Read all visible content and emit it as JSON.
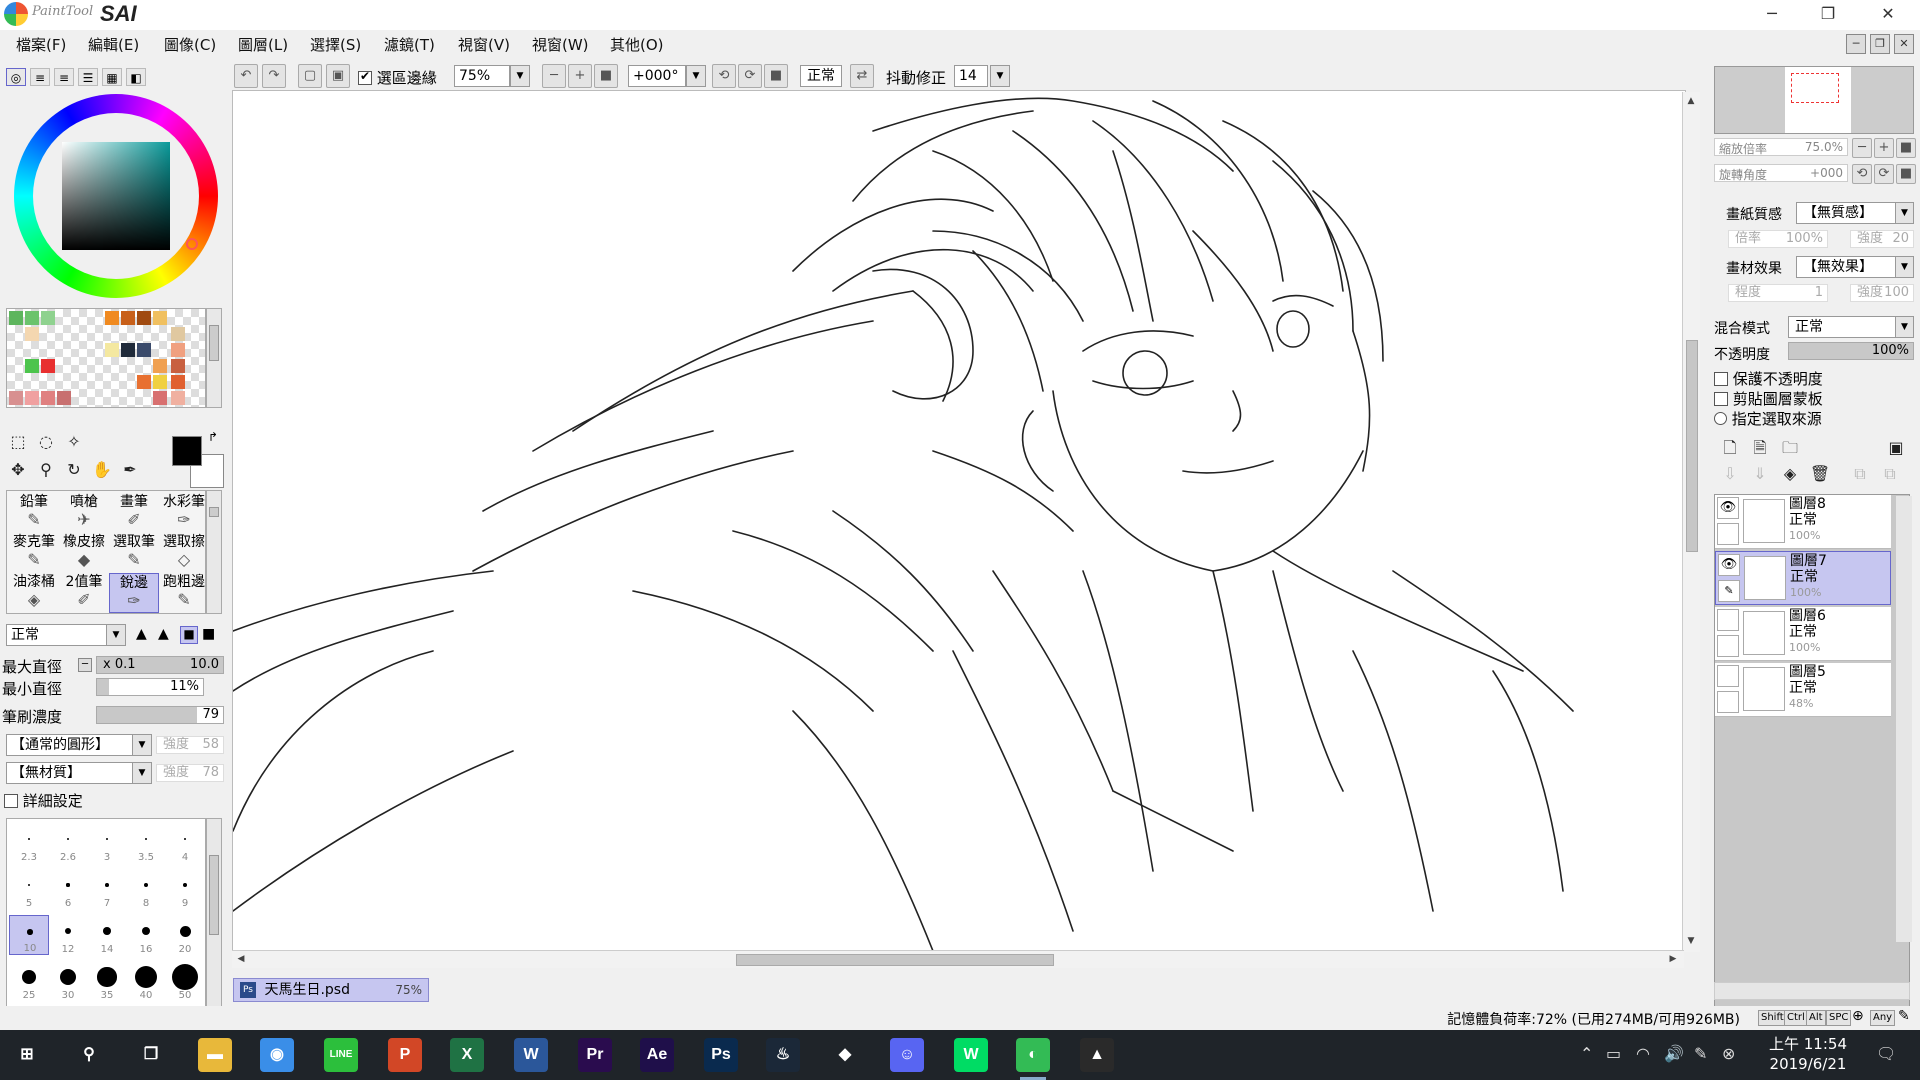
{
  "app": {
    "name_script": "PaintTool",
    "name_bold": "SAI",
    "window_controls": {
      "minimize": "─",
      "maximize": "❐",
      "close": "✕"
    }
  },
  "menu": [
    "檔案(F)",
    "編輯(E)",
    "圖像(C)",
    "圖層(L)",
    "選擇(S)",
    "濾鏡(T)",
    "視窗(V)",
    "視窗(W)",
    "其他(O)"
  ],
  "toolbar": {
    "selection_edge_label": "選區邊緣",
    "selection_edge_checked": true,
    "zoom": "75%",
    "rotation": "+000°",
    "blend_mode": "正常",
    "stabilizer_label": "抖動修正",
    "stabilizer_value": "14"
  },
  "brush_tools": [
    {
      "label": "鉛筆",
      "icon": "✎"
    },
    {
      "label": "噴槍",
      "icon": "✈"
    },
    {
      "label": "畫筆",
      "icon": "✐"
    },
    {
      "label": "水彩筆",
      "icon": "✑"
    },
    {
      "label": "麥克筆",
      "icon": "✎"
    },
    {
      "label": "橡皮擦",
      "icon": "◆"
    },
    {
      "label": "選取筆",
      "icon": "✎"
    },
    {
      "label": "選取擦",
      "icon": "◇"
    },
    {
      "label": "油漆桶",
      "icon": "◈"
    },
    {
      "label": "2值筆",
      "icon": "✐"
    },
    {
      "label": "銳邊",
      "icon": "✑",
      "active": true
    },
    {
      "label": "跑粗邊",
      "icon": "✎"
    }
  ],
  "brush_settings": {
    "mode": "正常",
    "max_size_label": "最大直徑",
    "max_size_mult": "x 0.1",
    "max_size_value": "10.0",
    "min_size_label": "最小直徑",
    "min_size_value": "11%",
    "min_size_fraction": 0.11,
    "density_label": "筆刷濃度",
    "density_value": "79",
    "density_fraction": 0.79,
    "shape": "【通常的圓形】",
    "shape_strength_label": "強度",
    "shape_strength": "58",
    "texture": "【無材質】",
    "texture_strength_label": "強度",
    "texture_strength": "78",
    "advanced_label": "詳細設定"
  },
  "brush_sizes": [
    "2.3",
    "2.6",
    "3",
    "3.5",
    "4",
    "5",
    "6",
    "7",
    "8",
    "9",
    "10",
    "12",
    "14",
    "16",
    "20",
    "25",
    "30",
    "35",
    "40",
    "50"
  ],
  "active_brush_size": "10",
  "document": {
    "name": "天馬生日.psd",
    "zoom": "75%"
  },
  "navigator": {
    "zoom_label": "縮放倍率",
    "zoom_value": "75.0%",
    "rotate_label": "旋轉角度",
    "rotate_value": "+000"
  },
  "paper": {
    "texture_label": "畫紙質感",
    "texture_value": "【無質感】",
    "scale_label": "倍率",
    "scale_value": "100%",
    "strength_label": "強度",
    "strength_value": "20",
    "effect_label": "畫材效果",
    "effect_value": "【無效果】",
    "degree_label": "程度",
    "degree_value": "1",
    "effect_strength_label": "強度",
    "effect_strength_value": "100"
  },
  "layer_props": {
    "blend_label": "混合模式",
    "blend_value": "正常",
    "opacity_label": "不透明度",
    "opacity_value": "100%",
    "opacity_fraction": 1.0,
    "protect_opacity": "保護不透明度",
    "clip_layer": "剪貼圖層蒙板",
    "sample_source": "指定選取來源"
  },
  "layers": [
    {
      "name": "圖層8",
      "mode": "正常",
      "opacity": "100%",
      "visible": true,
      "selected": false
    },
    {
      "name": "圖層7",
      "mode": "正常",
      "opacity": "100%",
      "visible": true,
      "selected": true
    },
    {
      "name": "圖層6",
      "mode": "正常",
      "opacity": "100%",
      "visible": false,
      "selected": false
    },
    {
      "name": "圖層5",
      "mode": "正常",
      "opacity": "48%",
      "visible": false,
      "selected": false
    }
  ],
  "status": {
    "memory": "記憶體負荷率:72% (已用274MB/可用926MB)",
    "keys": [
      "Shift",
      "Ctrl",
      "Alt",
      "SPC",
      "Any"
    ]
  },
  "taskbar": {
    "apps": [
      {
        "name": "windows-start",
        "glyph": "⊞",
        "color": "transparent"
      },
      {
        "name": "search",
        "glyph": "⚲",
        "color": "transparent"
      },
      {
        "name": "task-view",
        "glyph": "❐",
        "color": "transparent"
      },
      {
        "name": "file-explorer",
        "glyph": "▬",
        "color": "#e8b83a"
      },
      {
        "name": "chrome",
        "glyph": "◉",
        "color": "#3a8ee8"
      },
      {
        "name": "line",
        "glyph": "LINE",
        "color": "#2cbf3c"
      },
      {
        "name": "powerpoint",
        "glyph": "P",
        "color": "#d24726"
      },
      {
        "name": "excel",
        "glyph": "X",
        "color": "#1f7244"
      },
      {
        "name": "word",
        "glyph": "W",
        "color": "#2b579a"
      },
      {
        "name": "premiere",
        "glyph": "Pr",
        "color": "#2a0c4e"
      },
      {
        "name": "after-effects",
        "glyph": "Ae",
        "color": "#1f0f4a"
      },
      {
        "name": "photoshop",
        "glyph": "Ps",
        "color": "#0a2a4e"
      },
      {
        "name": "steam",
        "glyph": "♨",
        "color": "#1b2838"
      },
      {
        "name": "sims",
        "glyph": "◆",
        "color": "#1f2429"
      },
      {
        "name": "discord",
        "glyph": "☺",
        "color": "#5865f2"
      },
      {
        "name": "webtoon",
        "glyph": "W",
        "color": "#00dc64"
      },
      {
        "name": "painttool-sai",
        "glyph": "◐",
        "color": "#3b5",
        "running": true
      },
      {
        "name": "photos",
        "glyph": "▲",
        "color": "#2a2a2a"
      }
    ],
    "time": "上午 11:54",
    "date": "2019/6/21"
  }
}
